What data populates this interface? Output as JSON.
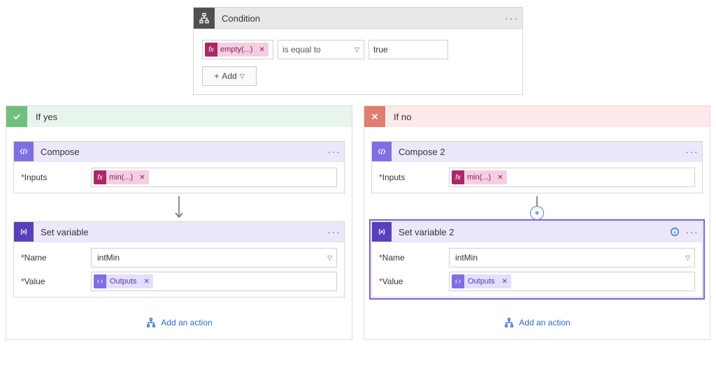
{
  "condition": {
    "title": "Condition",
    "left_token": "empty(...)",
    "operator": "is equal to",
    "value": "true",
    "add_label": "Add"
  },
  "yes": {
    "label": "If yes",
    "compose": {
      "title": "Compose",
      "inputs_label": "Inputs",
      "token": "min(...)"
    },
    "setvar": {
      "title": "Set variable",
      "name_label": "Name",
      "name_value": "intMin",
      "value_label": "Value",
      "value_token": "Outputs"
    },
    "add_action": "Add an action"
  },
  "no": {
    "label": "If no",
    "compose": {
      "title": "Compose 2",
      "inputs_label": "Inputs",
      "token": "min(...)"
    },
    "setvar": {
      "title": "Set variable 2",
      "name_label": "Name",
      "name_value": "intMin",
      "value_label": "Value",
      "value_token": "Outputs"
    },
    "add_action": "Add an action"
  },
  "icons": {
    "fx": "fx"
  }
}
